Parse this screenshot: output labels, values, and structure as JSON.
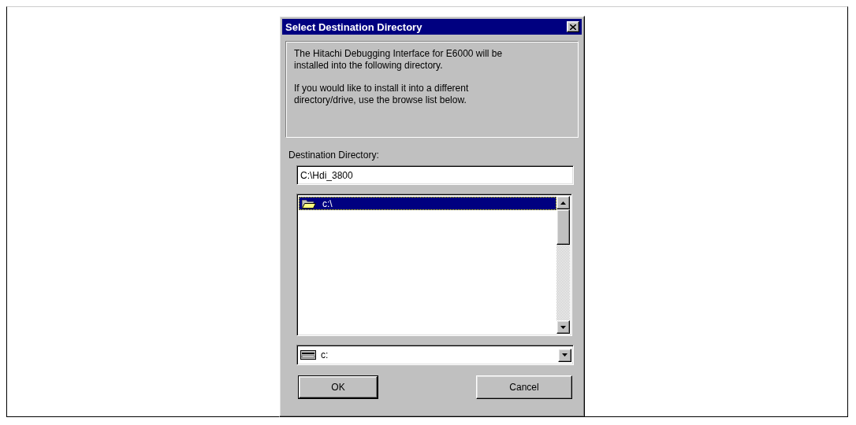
{
  "window": {
    "title": "Select Destination Directory"
  },
  "message": [
    "The Hitachi Debugging Interface for E6000 will be installed into the following directory.",
    "If you would like to install it into a different directory/drive, use the browse list below."
  ],
  "destination_label": "Destination Directory:",
  "destination_field": {
    "value": "C:\\Hdi_3800"
  },
  "directory_list": {
    "items": [
      {
        "label": "c:\\",
        "selected": true
      }
    ]
  },
  "drive_combo": {
    "value": "c:"
  },
  "buttons": [
    {
      "label": "OK",
      "default": true
    },
    {
      "label": "Cancel",
      "default": false
    }
  ]
}
